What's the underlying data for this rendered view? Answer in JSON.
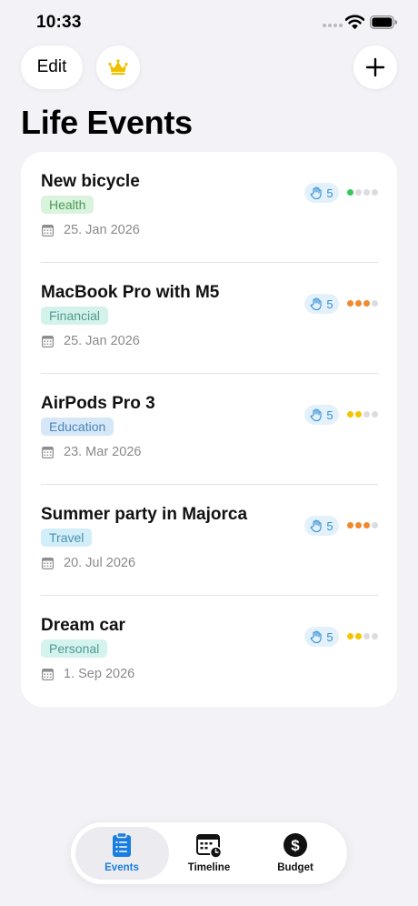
{
  "status_bar": {
    "time": "10:33"
  },
  "header": {
    "edit_label": "Edit",
    "crown_icon": "crown-icon",
    "add_icon": "plus-icon",
    "title": "Life Events"
  },
  "colors": {
    "background": "#f2f2f7",
    "accent": "#1a7ee0",
    "crown": "#f0c000",
    "priority_green": "#34c759",
    "priority_orange": "#ef8a2e",
    "priority_yellow": "#f5c400",
    "priority_empty": "#dcdcdf"
  },
  "events": [
    {
      "title": "New bicycle",
      "category": "Health",
      "category_bg": "#d9f3dc",
      "category_color": "#4e9a5a",
      "date": "25. Jan 2026",
      "attendees": "5",
      "priority": 1,
      "priority_color": "#34c759"
    },
    {
      "title": "MacBook Pro with M5",
      "category": "Financial",
      "category_bg": "#d4f2ec",
      "category_color": "#4f9a8c",
      "date": "25. Jan 2026",
      "attendees": "5",
      "priority": 3,
      "priority_color": "#ef8a2e"
    },
    {
      "title": "AirPods Pro 3",
      "category": "Education",
      "category_bg": "#d6e8f8",
      "category_color": "#4d86b8",
      "date": "23. Mar 2026",
      "attendees": "5",
      "priority": 2,
      "priority_color": "#f5c400"
    },
    {
      "title": "Summer party in Majorca",
      "category": "Travel",
      "category_bg": "#d2eef8",
      "category_color": "#4b93ae",
      "date": "20. Jul 2026",
      "attendees": "5",
      "priority": 3,
      "priority_color": "#ef8a2e"
    },
    {
      "title": "Dream car",
      "category": "Personal",
      "category_bg": "#d4f2ee",
      "category_color": "#4e9a90",
      "date": "1. Sep 2026",
      "attendees": "5",
      "priority": 2,
      "priority_color": "#f5c400"
    }
  ],
  "tabs": [
    {
      "label": "Events",
      "icon": "clipboard-icon",
      "active": true
    },
    {
      "label": "Timeline",
      "icon": "calendar-clock-icon",
      "active": false
    },
    {
      "label": "Budget",
      "icon": "dollar-icon",
      "active": false
    }
  ]
}
